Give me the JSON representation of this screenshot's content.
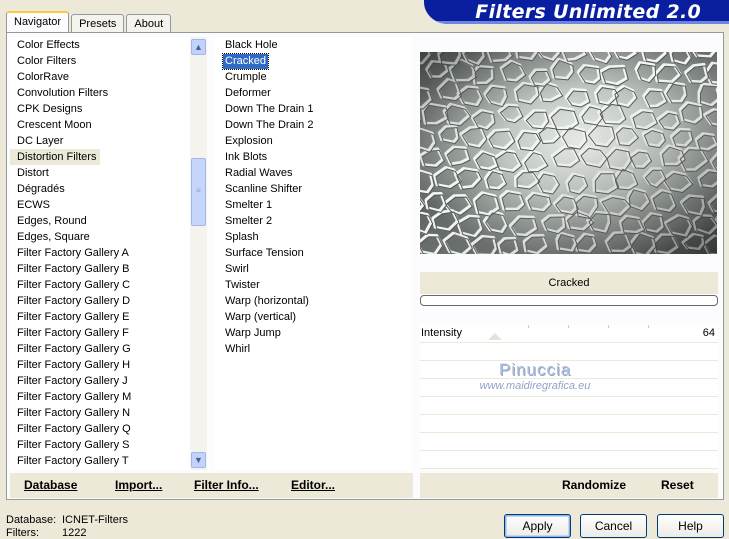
{
  "app_title": "Filters Unlimited 2.0",
  "tabs": [
    {
      "label": "Navigator",
      "active": true
    },
    {
      "label": "Presets",
      "active": false
    },
    {
      "label": "About",
      "active": false
    }
  ],
  "categories": [
    "Color Effects",
    "Color Filters",
    "ColorRave",
    "Convolution Filters",
    "CPK Designs",
    "Crescent Moon",
    "DC Layer",
    "Distortion Filters",
    "Distort",
    "Dégradés",
    "ECWS",
    "Edges, Round",
    "Edges, Square",
    "Filter Factory Gallery A",
    "Filter Factory Gallery B",
    "Filter Factory Gallery C",
    "Filter Factory Gallery D",
    "Filter Factory Gallery E",
    "Filter Factory Gallery F",
    "Filter Factory Gallery G",
    "Filter Factory Gallery H",
    "Filter Factory Gallery J",
    "Filter Factory Gallery M",
    "Filter Factory Gallery N",
    "Filter Factory Gallery Q",
    "Filter Factory Gallery S",
    "Filter Factory Gallery T"
  ],
  "selected_category": "Distortion Filters",
  "filters": [
    "Black Hole",
    "Cracked",
    "Crumple",
    "Deformer",
    "Down The Drain 1",
    "Down The Drain 2",
    "Explosion",
    "Ink Blots",
    "Radial Waves",
    "Scanline Shifter",
    "Smelter 1",
    "Smelter 2",
    "Splash",
    "Surface Tension",
    "Swirl",
    "Twister",
    "Warp (horizontal)",
    "Warp (vertical)",
    "Warp Jump",
    "Whirl"
  ],
  "selected_filter": "Cracked",
  "preview_filter_name": "Cracked",
  "parameters": [
    {
      "label": "Intensity",
      "value": "64"
    }
  ],
  "watermark": {
    "name": "Pinuccia",
    "url": "www.maidiregrafica.eu"
  },
  "toolbar": {
    "database": "Database",
    "import": "Import...",
    "filter_info": "Filter Info...",
    "editor": "Editor...",
    "randomize": "Randomize",
    "reset": "Reset"
  },
  "footer": {
    "database_label": "Database:",
    "database_value": "ICNET-Filters",
    "filters_label": "Filters:",
    "filters_value": "1222"
  },
  "buttons": {
    "apply": "Apply",
    "cancel": "Cancel",
    "help": "Help"
  },
  "colors": {
    "selection": "#316ac5",
    "banner": "#0a1fa0",
    "face": "#ece9d8"
  }
}
